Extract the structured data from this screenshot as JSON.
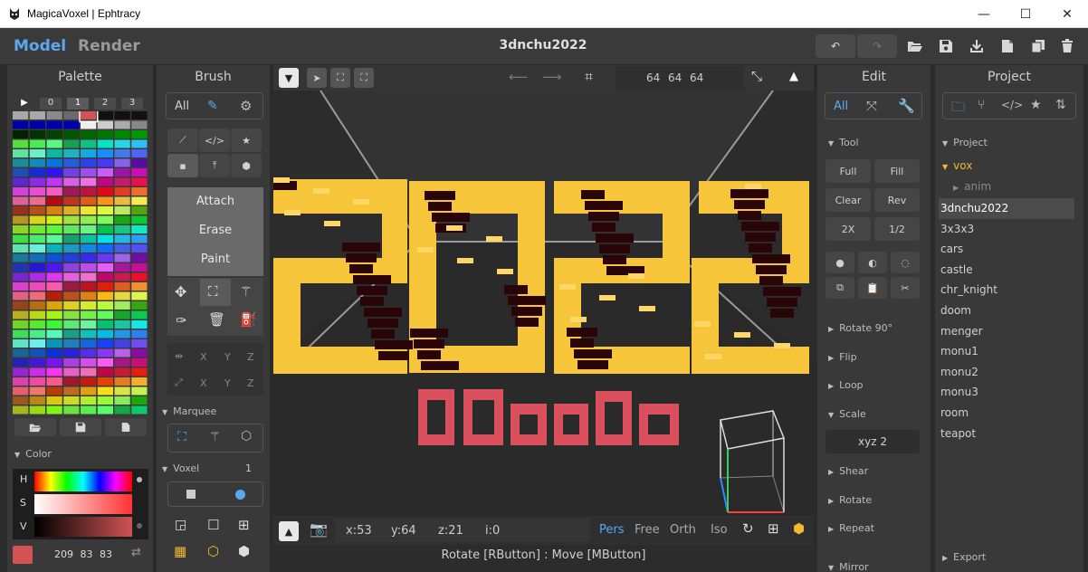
{
  "window": {
    "title": "MagicaVoxel | Ephtracy",
    "min": "—",
    "max": "☐",
    "close": "✕"
  },
  "topbar": {
    "model_tab": "Model",
    "render_tab": "Render",
    "filename": "3dnchu2022"
  },
  "palette": {
    "title": "Palette",
    "page_buttons": [
      "▶",
      "0",
      "1",
      "2",
      "3"
    ],
    "accent": "#d65353"
  },
  "color": {
    "section": "Color",
    "h": "H",
    "s": "S",
    "v": "V",
    "rgb": "209 83 83",
    "swatch": "#d15353"
  },
  "brush": {
    "title": "Brush",
    "filter_all": "All",
    "attach": "Attach",
    "erase": "Erase",
    "paint": "Paint",
    "axis": [
      "X",
      "Y",
      "Z",
      "X",
      "Y",
      "Z"
    ],
    "marquee": "Marquee",
    "voxel": "Voxel",
    "voxel_count": "1"
  },
  "viewport": {
    "dims": [
      "64",
      "64",
      "64"
    ],
    "coords": {
      "x": "x:53",
      "y": "y:64",
      "z": "z:21",
      "i": "i:0"
    },
    "cams": [
      "Pers",
      "Free",
      "Orth",
      "Iso"
    ],
    "active_cam": "Pers",
    "status": "Rotate [RButton] : Move [MButton]",
    "label3d": "3Dnchu"
  },
  "edit": {
    "title": "Edit",
    "filter_all": "All",
    "tool": "Tool",
    "buttons": [
      "Full",
      "Fill",
      "Clear",
      "Rev",
      "2X",
      "1/2"
    ],
    "rotate90": "Rotate 90°",
    "flip": "Flip",
    "loop": "Loop",
    "scale": "Scale",
    "scale_value": "xyz  2",
    "shear": "Shear",
    "rotate": "Rotate",
    "repeat": "Repeat",
    "mirror": "Mirror"
  },
  "project": {
    "title": "Project",
    "section": "Project",
    "folder": "vox",
    "subfolder": "anim",
    "items": [
      "3dnchu2022",
      "3x3x3",
      "cars",
      "castle",
      "chr_knight",
      "doom",
      "menger",
      "monu1",
      "monu2",
      "monu3",
      "room",
      "teapot"
    ],
    "selected": "3dnchu2022",
    "export": "Export"
  }
}
